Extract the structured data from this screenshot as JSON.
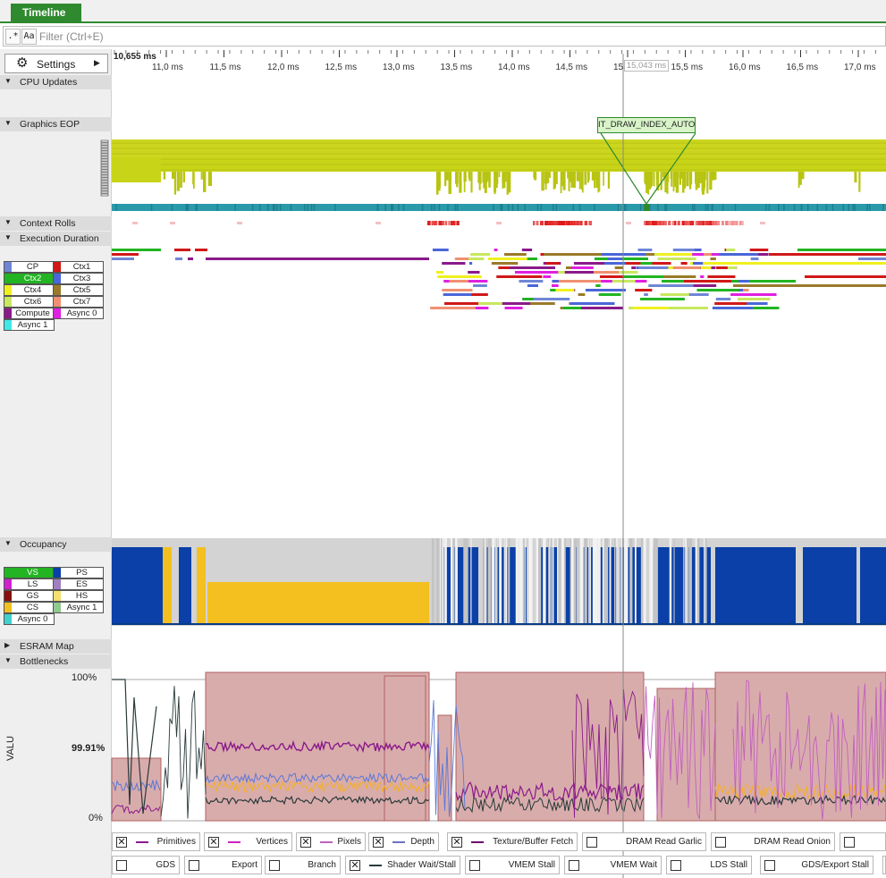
{
  "tab": {
    "label": "Timeline"
  },
  "filter": {
    "regex_label": ".*",
    "case_label": "Aa",
    "placeholder": "Filter (Ctrl+E)"
  },
  "settings": {
    "label": "Settings"
  },
  "sections": {
    "cpu_updates": "CPU Updates",
    "graphics_eop": "Graphics EOP",
    "context_rolls": "Context Rolls",
    "execution_duration": "Execution Duration",
    "occupancy": "Occupancy",
    "esram_map": "ESRAM Map",
    "bottlenecks": "Bottlenecks"
  },
  "ruler": {
    "start_label": "10,655 ms",
    "ticks": [
      "11,0 ms",
      "11,5 ms",
      "12,0 ms",
      "12,5 ms",
      "13,0 ms",
      "13,5 ms",
      "14,0 ms",
      "14,5 ms",
      "15,0 ms",
      "15,5 ms",
      "16,0 ms",
      "16,5 ms",
      "17,0 ms"
    ],
    "cursor_readout": "15,043 ms"
  },
  "callout": {
    "label": "IT_DRAW_INDEX_AUTO"
  },
  "exec_legend": [
    {
      "label": "CP",
      "color": "#6f86d6"
    },
    {
      "label": "Ctx1",
      "color": "#d01818"
    },
    {
      "label": "Ctx2",
      "color": "#22b422",
      "selected": true
    },
    {
      "label": "Ctx3",
      "color": "#4a66d8"
    },
    {
      "label": "Ctx4",
      "color": "#f0f020"
    },
    {
      "label": "Ctx5",
      "color": "#9a7a2a"
    },
    {
      "label": "Ctx6",
      "color": "#c8e860"
    },
    {
      "label": "Ctx7",
      "color": "#f09070"
    },
    {
      "label": "Compute",
      "color": "#8a1a8a"
    },
    {
      "label": "Async 0",
      "color": "#e020e0"
    },
    {
      "label": "Async 1",
      "color": "#40e8e8"
    }
  ],
  "occ_legend": [
    {
      "label": "VS",
      "color": "#22b422",
      "selected": true
    },
    {
      "label": "PS",
      "color": "#0a40a8"
    },
    {
      "label": "LS",
      "color": "#d020d0"
    },
    {
      "label": "ES",
      "color": "#a080c0"
    },
    {
      "label": "GS",
      "color": "#8a1010"
    },
    {
      "label": "HS",
      "color": "#f4e070"
    },
    {
      "label": "CS",
      "color": "#f4c020"
    },
    {
      "label": "Async 1",
      "color": "#90c890"
    },
    {
      "label": "Async 0",
      "color": "#40d0d0"
    }
  ],
  "bottleneck_axis": {
    "ylabel": "VALU",
    "top": "100%",
    "mid": "99.91%",
    "bottom": "0%"
  },
  "counters_row1": [
    {
      "label": "Primitives",
      "checked": true,
      "color": "#8a1a8a"
    },
    {
      "label": "Vertices",
      "checked": true,
      "color": "#d020c0"
    },
    {
      "label": "Pixels",
      "checked": true,
      "color": "#c060c0"
    },
    {
      "label": "Depth",
      "checked": true,
      "color": "#7070c0"
    },
    {
      "label": "Texture/Buffer Fetch",
      "checked": true,
      "color": "#6a0a6a"
    },
    {
      "label": "DRAM Read Garlic",
      "checked": false
    },
    {
      "label": "DRAM Read Onion",
      "checked": false
    },
    {
      "label": "",
      "checked": false
    }
  ],
  "counters_row2": [
    {
      "label": "GDS",
      "checked": false
    },
    {
      "label": "Export",
      "checked": false
    },
    {
      "label": "Branch",
      "checked": false
    },
    {
      "label": "Shader Wait/Stall",
      "checked": true,
      "color": "#2a3a3a"
    },
    {
      "label": "VMEM Stall",
      "checked": false
    },
    {
      "label": "VMEM Wait",
      "checked": false
    },
    {
      "label": "LDS Stall",
      "checked": false
    },
    {
      "label": "GDS/Export Stall",
      "checked": false
    },
    {
      "label": "",
      "checked": false
    }
  ]
}
